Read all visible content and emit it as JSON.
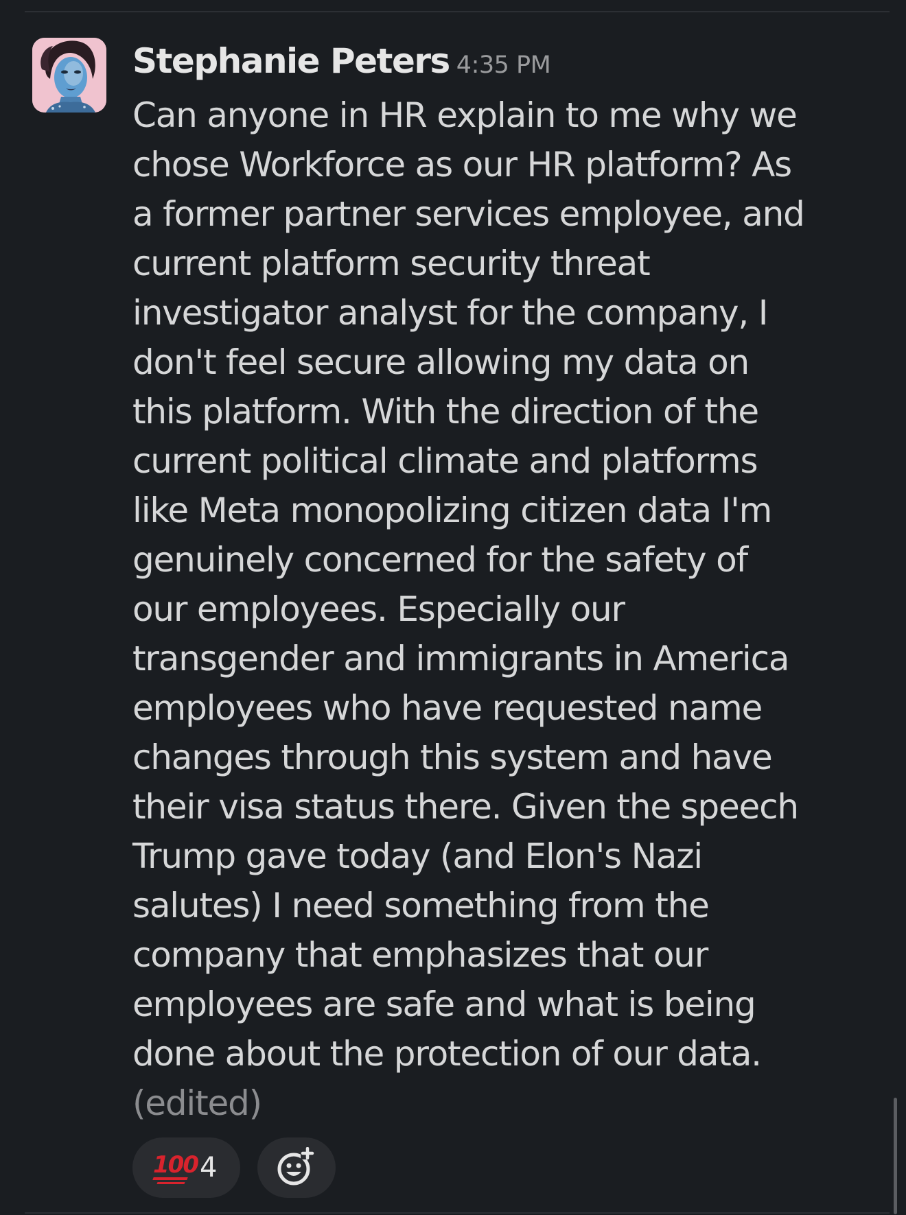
{
  "message": {
    "sender_name": "Stephanie Peters",
    "timestamp": "4:35 PM",
    "lines": [
      "Can anyone in HR explain to me why we",
      "chose Workforce as our HR platform? As",
      "a former partner services employee, and",
      "current platform security threat",
      "investigator analyst for the company, I",
      "don't feel secure allowing my data on",
      "this platform. With the direction of the",
      "current political climate and platforms",
      "like Meta monopolizing citizen data I'm",
      "genuinely concerned for the safety of",
      "our employees. Especially our",
      "transgender and immigrants in America",
      "employees who have requested name",
      "changes through this system and have",
      "their visa status there. Given the speech",
      "Trump gave today (and Elon's Nazi",
      "salutes) I need something from the",
      "company that emphasizes that our",
      "employees are safe and what is being",
      "done about the protection of our data."
    ],
    "edited_label": "(edited)"
  },
  "reactions": [
    {
      "emoji_text": "100",
      "emoji_name": "hundred-points-emoji",
      "count": "4"
    }
  ],
  "add_reaction_icon": "add-reaction-icon",
  "colors": {
    "background": "#1a1d21",
    "text": "#d6d7d8",
    "muted": "#9a9b9d",
    "reaction_pill": "#2a2c30",
    "hundred_red": "#d9232d"
  }
}
